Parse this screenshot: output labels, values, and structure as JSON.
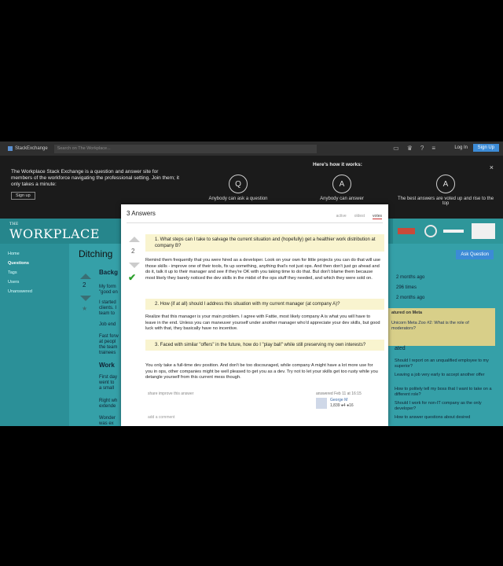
{
  "topbar": {
    "brand": "StackExchange",
    "search_placeholder": "Search on The Workplace...",
    "login": "Log In",
    "signup": "Sign Up",
    "icons": [
      "inbox-icon",
      "trophy-icon",
      "help-icon",
      "hamburger-icon"
    ]
  },
  "hero": {
    "intro": "The Workplace Stack Exchange is a question and answer site for members of the workforce navigating the professional setting. Join them; it only takes a minute:",
    "signup": "Sign up",
    "how_title": "Here's how it works:",
    "steps": [
      {
        "icon": "Q",
        "label": "Anybody can ask a question"
      },
      {
        "icon": "A",
        "label": "Anybody can answer"
      },
      {
        "icon": "A",
        "label": "The best answers are voted up and rise to the top"
      }
    ],
    "close": "×"
  },
  "site": {
    "logo_the": "THE",
    "logo_name": "WORKPLACE"
  },
  "nav": {
    "items": [
      "Home",
      "Questions",
      "Tags",
      "Users",
      "Unanswered"
    ]
  },
  "question": {
    "title": "Ditching",
    "ask_button": "Ask Question",
    "bg_heading": "Backg",
    "bg_lines": [
      "My form",
      "\"good en",
      "I started",
      "clients. I",
      "team to",
      "Job end",
      "Fast forw",
      "at peopl",
      "the team",
      "trainees"
    ],
    "bg_heading2": "Work",
    "bg_lines2": [
      "First day",
      "went to",
      "a small",
      "Right wh",
      "extende",
      "Wonder",
      "was ex"
    ],
    "vote_count": "2"
  },
  "stats": {
    "asked": "2 months ago",
    "viewed": "296 times",
    "active": "2 months ago"
  },
  "meta": {
    "title": "atured on Meta",
    "link": "Unicorn Meta Zoo #2: What is the role of moderators?"
  },
  "related": {
    "title": "ated",
    "items": [
      "Should I report on an unqualified employee to my superior?",
      "Leaving a job very early to accept another offer",
      "How to politely tell my boss that I want to take on a different role?",
      "Should I work for non-IT company as the only developer?",
      "How to answer questions about desired"
    ]
  },
  "answer": {
    "header": "3 Answers",
    "sort_tabs": [
      "active",
      "oldest",
      "votes"
    ],
    "vote_count": "2",
    "q1": "1. What steps can I take to salvage the current situation and (hopefully) get a healthier work distribution at company B?",
    "p1": "Remind them frequently that you were hired as a developer. Look on your own for little projects you can do that will use those skills - improve one of their tools, fix up something, anything that's not just ops. And then don't just go ahead and do it, talk it up to their manager and see if they're OK with you taking time to do that. But don't blame them because most likely they barely noticed the dev skills in the midst of the ops stuff they needed, and which they were sold on.",
    "q2": "2. How (if at all) should I address this situation with my current manager (at company A)?",
    "p2": "Realize that this manager is your main problem. I agree with Fattie, most likely company A is what you will have to leave in the end. Unless you can maneuver yourself under another manager who'd appreciate your dev skills, but good luck with that, they basically have no incentive.",
    "q3": "3. Faced with similar \"offers\" in the future, how do I \"play ball\" while still preserving my own interests?",
    "p3": "You only take a full-time dev position. And don't be too discouraged, while company A might have a lot more use for you in ops, other companies might be well pleased to get you as a dev. Try not to let your skills get too rusty while you detangle yourself from this current mess though.",
    "actions": "share  improve this answer",
    "answered": "answered Feb 11 at 16:15",
    "user_name": "George M",
    "user_rep": "1,839  ●4  ●16",
    "add_comment": "add a comment"
  },
  "colors": {
    "teal": "#2b9098",
    "accepted": "#2ca02c",
    "highlight": "#f9f4cf",
    "button": "#3c8bd6"
  }
}
